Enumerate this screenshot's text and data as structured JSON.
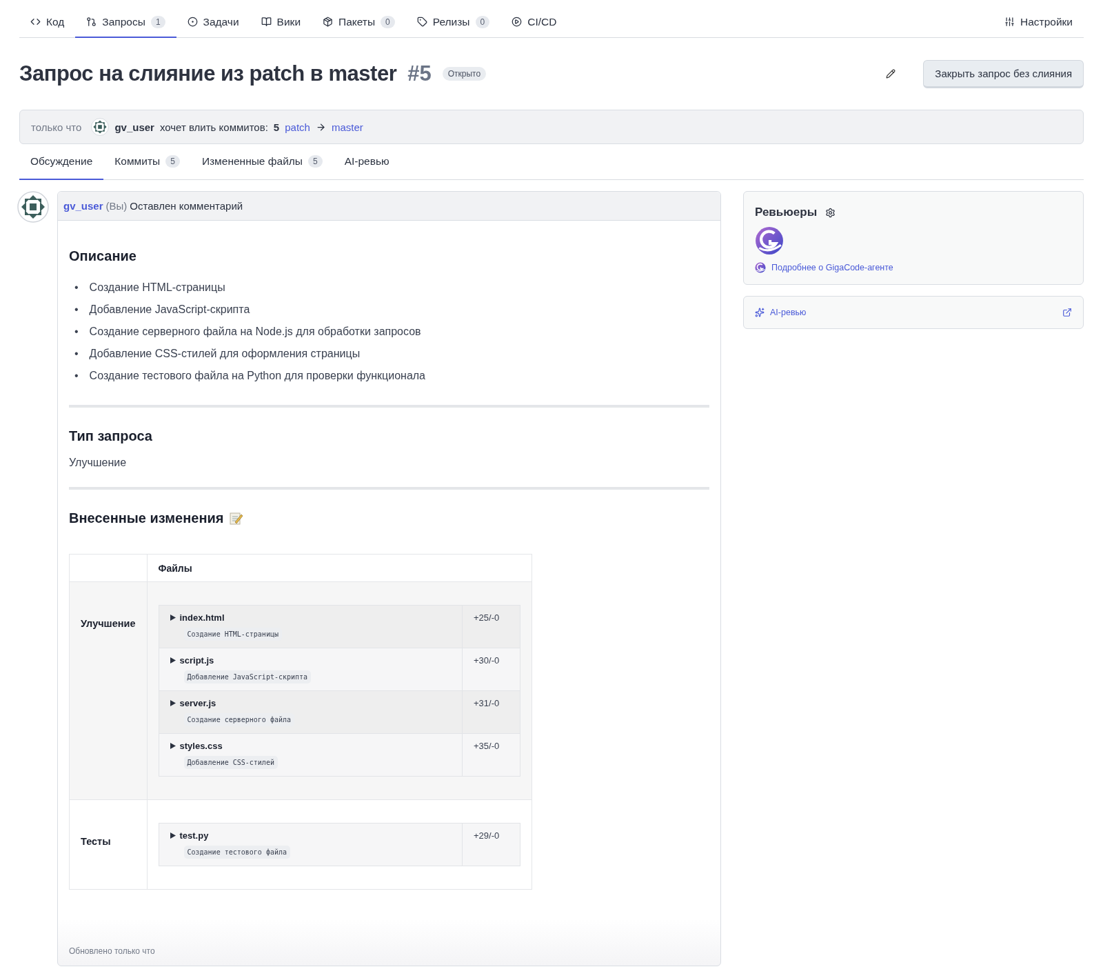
{
  "nav": {
    "tabs": [
      {
        "label": "Код",
        "selected": false
      },
      {
        "label": "Запросы",
        "count": "1",
        "selected": true
      },
      {
        "label": "Задачи",
        "selected": false
      },
      {
        "label": "Вики",
        "selected": false
      },
      {
        "label": "Пакеты",
        "count": "0",
        "selected": false
      },
      {
        "label": "Релизы",
        "count": "0",
        "selected": false
      },
      {
        "label": "CI/CD",
        "selected": false
      }
    ],
    "settings": "Настройки"
  },
  "header": {
    "title": "Запрос на слияние из patch в master",
    "number": "#5",
    "status": "Открыто",
    "close_button": "Закрыть запрос без слияния"
  },
  "meta": {
    "time": "только что",
    "user": "gv_user",
    "text": "хочет влить коммитов:",
    "count": "5",
    "source": "patch",
    "target": "master"
  },
  "subtabs": [
    {
      "label": "Обсуждение",
      "selected": true
    },
    {
      "label": "Коммиты",
      "count": "5",
      "selected": false
    },
    {
      "label": "Измененные файлы",
      "count": "5",
      "selected": false
    },
    {
      "label": "AI-ревью",
      "selected": false
    }
  ],
  "comment": {
    "user": "gv_user",
    "you": "(Вы)",
    "action": "Оставлен комментарий",
    "sections": [
      {
        "kind": "list",
        "heading": "Описание",
        "bullet": "•",
        "items": [
          "Создание HTML-страницы",
          "Добавление JavaScript-скрипта",
          "Создание серверного файла на Node.js для обработки запросов",
          "Добавление CSS-стилей для оформления страницы",
          "Создание тестового файла на Python для проверки функционала"
        ]
      },
      {
        "kind": "text",
        "heading": "Тип запроса",
        "text": "Улучшение"
      },
      {
        "kind": "table",
        "heading": "Внесенные изменения",
        "header": "Файлы",
        "groups": [
          {
            "label": "Улучшение",
            "files": [
              {
                "name": "index.html",
                "note": "Создание HTML-страницы",
                "stat": "+25/-0"
              },
              {
                "name": "script.js",
                "note": "Добавление JavaScript-скрипта",
                "stat": "+30/-0"
              },
              {
                "name": "server.js",
                "note": "Создание серверного файла",
                "stat": "+31/-0"
              },
              {
                "name": "styles.css",
                "note": "Добавление CSS-стилей",
                "stat": "+35/-0"
              }
            ]
          },
          {
            "label": "Тесты",
            "files": [
              {
                "name": "test.py",
                "note": "Создание тестового файла",
                "stat": "+29/-0"
              }
            ]
          }
        ]
      }
    ],
    "updated": "Обновлено только что"
  },
  "sidebar": {
    "reviewers_title": "Ревьюеры",
    "more_link": "Подробнее о GigaCode-агенте",
    "ai_review": "AI-ревью"
  }
}
